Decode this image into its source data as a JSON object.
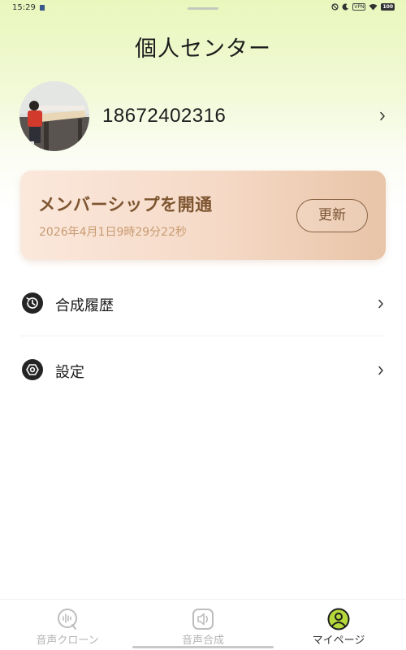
{
  "status_bar": {
    "time": "15:29",
    "vpn": "VPN",
    "battery": "100"
  },
  "page": {
    "title": "個人センター"
  },
  "profile": {
    "phone": "18672402316"
  },
  "membership": {
    "title": "メンバーシップを開通",
    "expiry": "2026年4月1日9時29分22秒",
    "renew_label": "更新"
  },
  "menu": [
    {
      "label": "合成履歴",
      "icon": "history-icon"
    },
    {
      "label": "設定",
      "icon": "settings-icon"
    }
  ],
  "bottom_nav": [
    {
      "label": "音声クローン",
      "icon": "voice-clone-icon",
      "active": false
    },
    {
      "label": "音声合成",
      "icon": "speaker-icon",
      "active": false
    },
    {
      "label": "マイページ",
      "icon": "user-icon",
      "active": true
    }
  ],
  "colors": {
    "header_gradient": "#e9f7bc",
    "card_text": "#7d5530",
    "card_subtext": "#c99b72",
    "active_nav": "#b5d93a"
  }
}
